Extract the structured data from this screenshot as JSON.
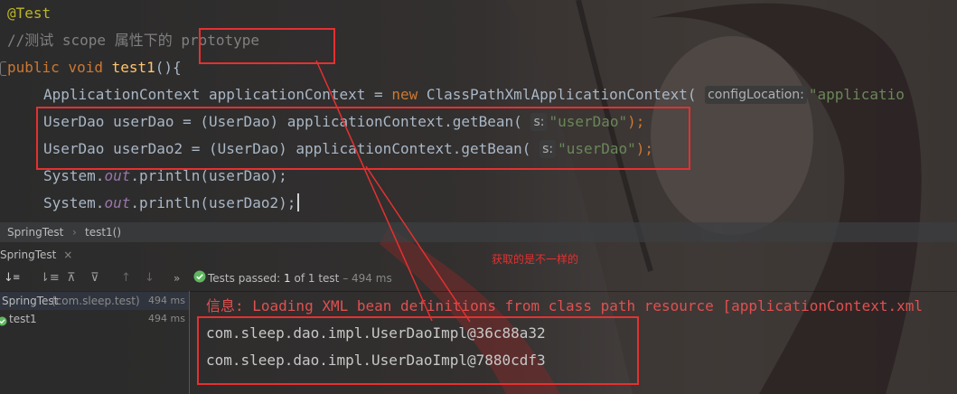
{
  "code": {
    "line1": "@Test",
    "line2": "//测试 scope 属性下的 prototype",
    "line3_kw1": "public",
    "line3_kw2": "void",
    "line3_fn": "test1",
    "line3_rest": "(){",
    "line4_start": "ApplicationContext applicationContext = ",
    "line4_new": "new",
    "line4_mid": " ClassPathXmlApplicationContext(",
    "line4_hint": "configLocation:",
    "line4_str": "\"applicatio",
    "line5_start": "UserDao userDao = (UserDao) applicationContext.getBean(",
    "line5_hint": "s:",
    "line5_str": "\"userDao\"",
    "line5_end": ");",
    "line6_start": "UserDao userDao2 = (UserDao) applicationContext.getBean(",
    "line6_hint": "s:",
    "line6_str": "\"userDao\"",
    "line6_end": ");",
    "line7_start": "System.",
    "line7_field": "out",
    "line7_end": ".println(userDao);",
    "line8_start": "System.",
    "line8_field": "out",
    "line8_end": ".println(userDao2);"
  },
  "breadcrumb": {
    "item1": "SpringTest",
    "sep": "›",
    "item2": "test1()"
  },
  "run": {
    "tab_label": "SpringTest",
    "close_symbol": "×",
    "tests_passed_label": "Tests passed:",
    "tests_passed_count": "1",
    "tests_passed_of": "of 1 test",
    "tests_passed_time": "– 494 ms"
  },
  "tree": {
    "root_label": "SpringTest",
    "root_pkg": "(com.sleep.test)",
    "root_time": "494 ms",
    "child_label": "test1",
    "child_time": "494 ms"
  },
  "console": {
    "info_line": "信息: Loading XML bean definitions from class path resource [applicationContext.xml",
    "out1": "com.sleep.dao.impl.UserDaoImpl@36c88a32",
    "out2": "com.sleep.dao.impl.UserDaoImpl@7880cdf3"
  },
  "annotation": {
    "note": "获取的是不一样的"
  },
  "colors": {
    "background": "#2b2b2b",
    "annotation_red": "#e53030",
    "keyword": "#cc7832",
    "string": "#6a8759",
    "method": "#ffc66d",
    "field": "#9876aa",
    "error_text": "#e05050",
    "pass_green": "#5fb760"
  }
}
